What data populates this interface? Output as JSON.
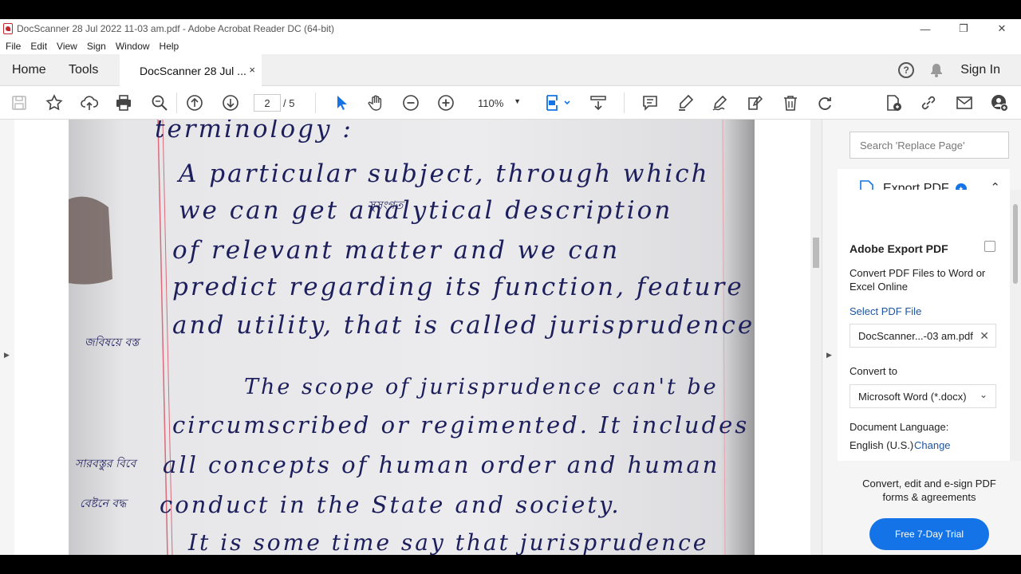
{
  "window": {
    "title": "DocScanner 28 Jul 2022 11-03 am.pdf - Adobe Acrobat Reader DC (64-bit)",
    "minimize": "—",
    "maximize": "❐",
    "close": "✕"
  },
  "menu": [
    "File",
    "Edit",
    "View",
    "Sign",
    "Window",
    "Help"
  ],
  "tabs": {
    "home": "Home",
    "tools": "Tools",
    "document": "DocScanner 28 Jul ...",
    "document_close": "×",
    "help": "?",
    "sign_in": "Sign In"
  },
  "toolbar": {
    "page_current": "2",
    "page_total": "/ 5",
    "zoom": "110%",
    "icons": [
      "save-icon",
      "star-icon",
      "upload-icon",
      "print-icon",
      "search-icon",
      "page-up-icon",
      "page-down-icon",
      "select-cursor-icon",
      "hand-icon",
      "zoom-out-icon",
      "zoom-in-icon",
      "fit-page-icon",
      "scroll-mode-icon",
      "comment-icon",
      "highlight-icon",
      "sign-icon",
      "fill-sign-icon",
      "delete-icon",
      "rotate-icon",
      "export-pdf-icon",
      "share-link-icon",
      "email-icon",
      "add-user-icon"
    ]
  },
  "document": {
    "handwriting": [
      "terminology :",
      "A particular subject, through which",
      "we can get analytical description",
      "of relevant matter and we can",
      "predict regarding its function, feature",
      "and utility, that is called jurisprudence",
      "The scope of jurisprudence can't be",
      "circumscribed or regimented. It includes",
      "all concepts of human order and human",
      "conduct in the State and society.",
      "It is some time say that jurisprudence"
    ],
    "margin_notes": [
      "সুসংগত",
      "জবিষয়ে বস্ত",
      "সারবস্তুর বিবে",
      "বেষ্টনে বদ্ধ"
    ]
  },
  "right_panel": {
    "search_placeholder": "Search 'Replace Page'",
    "export_title": "Export PDF",
    "export_heading": "Adobe Export PDF",
    "export_desc": "Convert PDF Files to Word or Excel Online",
    "select_file_label": "Select PDF File",
    "selected_file": "DocScanner...-03 am.pdf",
    "convert_to_label": "Convert to",
    "convert_to_value": "Microsoft Word (*.docx)",
    "doc_language_label": "Document Language:",
    "doc_language_value": "English (U.S.)",
    "change_link": "Change",
    "promo_text": "Convert, edit and e-sign PDF forms & agreements",
    "trial_button": "Free 7-Day Trial"
  },
  "colors": {
    "accent": "#1473e6",
    "ink": "#1d1f5c",
    "margin_line": "#d96b7a"
  }
}
